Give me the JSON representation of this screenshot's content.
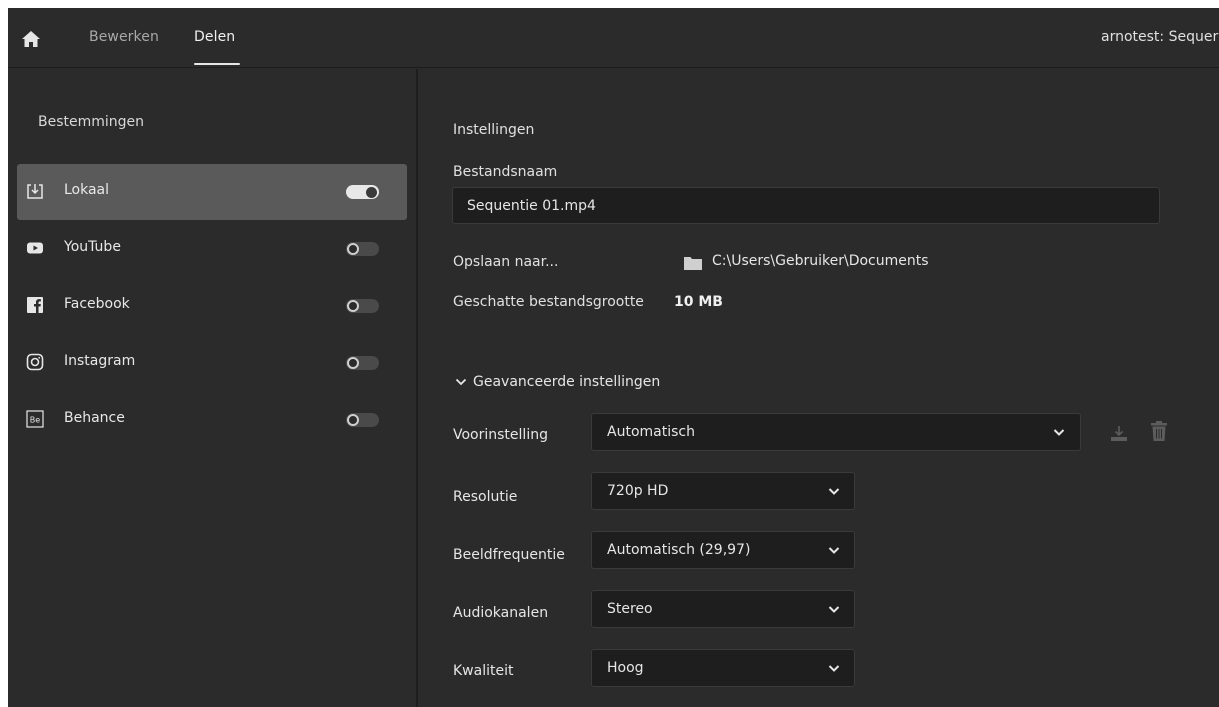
{
  "topbar": {
    "tabs": [
      {
        "label": "Bewerken",
        "active": false
      },
      {
        "label": "Delen",
        "active": true
      }
    ],
    "project_title": "arnotest: Sequer"
  },
  "sidebar": {
    "title": "Bestemmingen",
    "items": [
      {
        "label": "Lokaal",
        "icon": "local-export-icon",
        "enabled": true,
        "selected": true
      },
      {
        "label": "YouTube",
        "icon": "youtube-icon",
        "enabled": false,
        "selected": false
      },
      {
        "label": "Facebook",
        "icon": "facebook-icon",
        "enabled": false,
        "selected": false
      },
      {
        "label": "Instagram",
        "icon": "instagram-icon",
        "enabled": false,
        "selected": false
      },
      {
        "label": "Behance",
        "icon": "behance-icon",
        "enabled": false,
        "selected": false
      }
    ]
  },
  "main": {
    "section_title": "Instellingen",
    "filename": {
      "label": "Bestandsnaam",
      "value": "Sequentie 01.mp4"
    },
    "save_to": {
      "label": "Opslaan naar...",
      "path": "C:\\Users\\Gebruiker\\Documents"
    },
    "estimated_size": {
      "label": "Geschatte bestandsgrootte",
      "value": "10 MB"
    },
    "advanced": {
      "label": "Geavanceerde instellingen",
      "preset": {
        "label": "Voorinstelling",
        "value": "Automatisch"
      },
      "resolution": {
        "label": "Resolutie",
        "value": "720p HD"
      },
      "framerate": {
        "label": "Beeldfrequentie",
        "value": "Automatisch (29,97)"
      },
      "audio": {
        "label": "Audiokanalen",
        "value": "Stereo"
      },
      "quality": {
        "label": "Kwaliteit",
        "value": "Hoog"
      }
    }
  },
  "colors": {
    "background": "#2b2b2b",
    "active_item": "#5a5a5a",
    "input_bg": "#1e1e1e"
  }
}
